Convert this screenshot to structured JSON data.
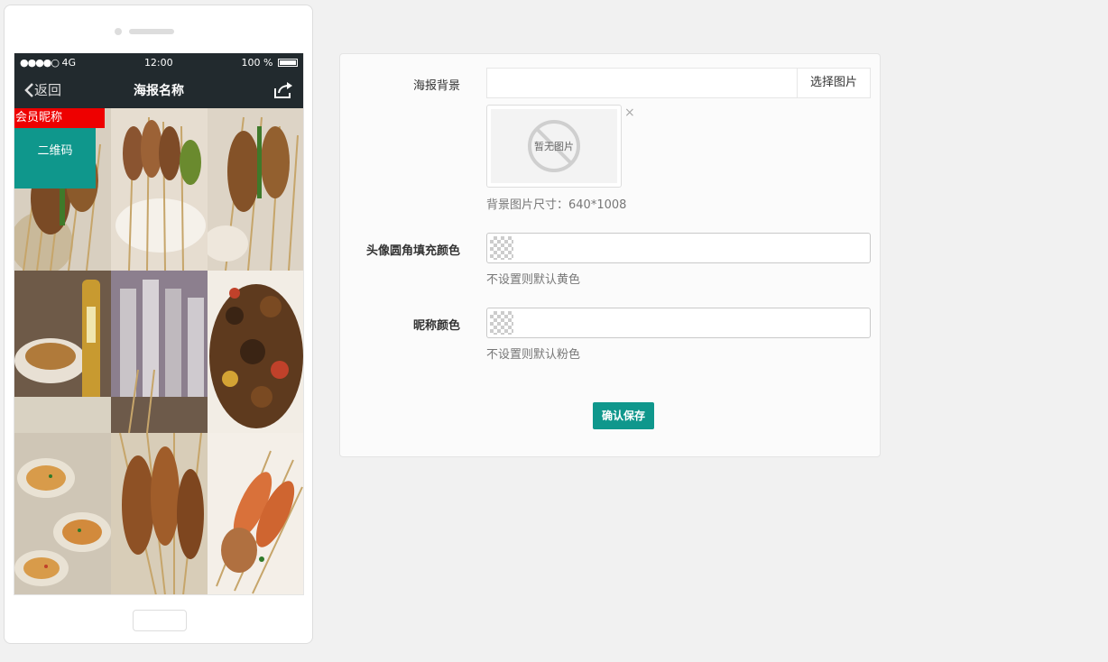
{
  "phone": {
    "status": {
      "signal": "●●●●○",
      "network": "4G",
      "time": "12:00",
      "battery": "100 %"
    },
    "nav": {
      "back_label": "返回",
      "title": "海报名称"
    },
    "poster": {
      "nickname_label": "会员昵称",
      "qrcode_label": "二维码"
    }
  },
  "form": {
    "background": {
      "label": "海报背景",
      "pick_button": "选择图片",
      "no_image_text": "暂无图片",
      "close_symbol": "×",
      "help": "背景图片尺寸：640*1008"
    },
    "avatar_fill": {
      "label": "头像圆角填充颜色",
      "help": "不设置则默认黄色"
    },
    "nickname_color": {
      "label": "昵称颜色",
      "help": "不设置则默认粉色"
    },
    "save_button": "确认保存"
  },
  "colors": {
    "accent": "#0f978c",
    "nickname_tag": "#ee0000",
    "navbar": "#222a2e"
  }
}
